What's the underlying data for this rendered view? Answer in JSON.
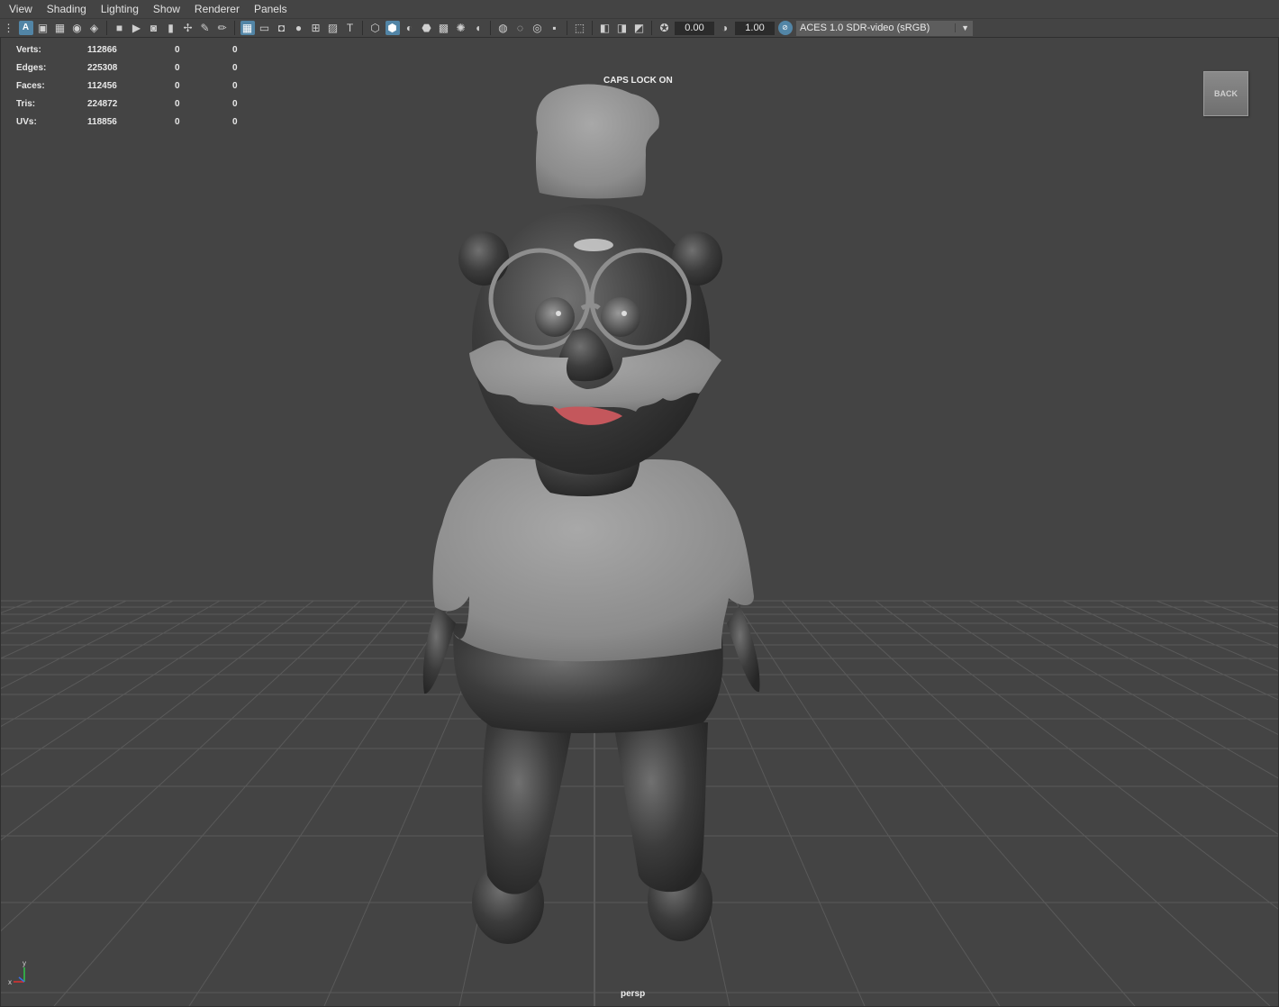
{
  "menubar": {
    "items": [
      "View",
      "Shading",
      "Lighting",
      "Show",
      "Renderer",
      "Panels"
    ]
  },
  "toolbar": {
    "select_camera_letter": "A",
    "exposure_value": "0.00",
    "gamma_value": "1.00",
    "color_space": "ACES 1.0 SDR-video (sRGB)",
    "icons": [
      "select-camera",
      "camera-attributes",
      "bookmarks",
      "image-plane",
      "grease-pencil",
      "2d-pan-zoom",
      "camera-settings",
      "bookmark",
      "grid",
      "film-gate",
      "resolution-gate",
      "gate-mask",
      "field-chart",
      "safe-action",
      "safe-title",
      "wireframe",
      "smooth-shade-all",
      "wireframe-on-shaded",
      "xray",
      "textured",
      "use-all-lights",
      "shadows",
      "screen-space-ambient-occlusion",
      "motion-blur",
      "multisample-antialiasing",
      "depth-of-field",
      "isolate-select",
      "xray-joints",
      "xray-active-components",
      "backface-culling",
      "exposure",
      "gamma",
      "color-management"
    ],
    "accent_color": "#5285a6"
  },
  "hud": {
    "rows": [
      {
        "label": "Verts:",
        "values": [
          "112866",
          "0",
          "0"
        ]
      },
      {
        "label": "Edges:",
        "values": [
          "225308",
          "0",
          "0"
        ]
      },
      {
        "label": "Faces:",
        "values": [
          "112456",
          "0",
          "0"
        ]
      },
      {
        "label": "Tris:",
        "values": [
          "224872",
          "0",
          "0"
        ]
      },
      {
        "label": "UVs:",
        "values": [
          "118856",
          "0",
          "0"
        ]
      }
    ]
  },
  "viewport": {
    "caps_lock_message": "CAPS LOCK ON",
    "back_button_label": "BACK",
    "camera_name": "persp",
    "axis_labels": {
      "y": "y",
      "x": "x"
    },
    "background_color": "#444444",
    "grid_color": "#5a5a5a"
  }
}
